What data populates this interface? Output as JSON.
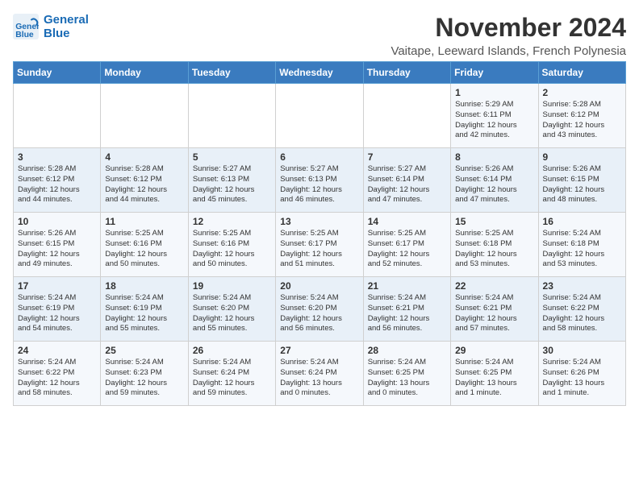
{
  "header": {
    "logo_line1": "General",
    "logo_line2": "Blue",
    "month_title": "November 2024",
    "location": "Vaitape, Leeward Islands, French Polynesia"
  },
  "weekdays": [
    "Sunday",
    "Monday",
    "Tuesday",
    "Wednesday",
    "Thursday",
    "Friday",
    "Saturday"
  ],
  "weeks": [
    [
      {
        "day": "",
        "info": ""
      },
      {
        "day": "",
        "info": ""
      },
      {
        "day": "",
        "info": ""
      },
      {
        "day": "",
        "info": ""
      },
      {
        "day": "",
        "info": ""
      },
      {
        "day": "1",
        "info": "Sunrise: 5:29 AM\nSunset: 6:11 PM\nDaylight: 12 hours\nand 42 minutes."
      },
      {
        "day": "2",
        "info": "Sunrise: 5:28 AM\nSunset: 6:12 PM\nDaylight: 12 hours\nand 43 minutes."
      }
    ],
    [
      {
        "day": "3",
        "info": "Sunrise: 5:28 AM\nSunset: 6:12 PM\nDaylight: 12 hours\nand 44 minutes."
      },
      {
        "day": "4",
        "info": "Sunrise: 5:28 AM\nSunset: 6:12 PM\nDaylight: 12 hours\nand 44 minutes."
      },
      {
        "day": "5",
        "info": "Sunrise: 5:27 AM\nSunset: 6:13 PM\nDaylight: 12 hours\nand 45 minutes."
      },
      {
        "day": "6",
        "info": "Sunrise: 5:27 AM\nSunset: 6:13 PM\nDaylight: 12 hours\nand 46 minutes."
      },
      {
        "day": "7",
        "info": "Sunrise: 5:27 AM\nSunset: 6:14 PM\nDaylight: 12 hours\nand 47 minutes."
      },
      {
        "day": "8",
        "info": "Sunrise: 5:26 AM\nSunset: 6:14 PM\nDaylight: 12 hours\nand 47 minutes."
      },
      {
        "day": "9",
        "info": "Sunrise: 5:26 AM\nSunset: 6:15 PM\nDaylight: 12 hours\nand 48 minutes."
      }
    ],
    [
      {
        "day": "10",
        "info": "Sunrise: 5:26 AM\nSunset: 6:15 PM\nDaylight: 12 hours\nand 49 minutes."
      },
      {
        "day": "11",
        "info": "Sunrise: 5:25 AM\nSunset: 6:16 PM\nDaylight: 12 hours\nand 50 minutes."
      },
      {
        "day": "12",
        "info": "Sunrise: 5:25 AM\nSunset: 6:16 PM\nDaylight: 12 hours\nand 50 minutes."
      },
      {
        "day": "13",
        "info": "Sunrise: 5:25 AM\nSunset: 6:17 PM\nDaylight: 12 hours\nand 51 minutes."
      },
      {
        "day": "14",
        "info": "Sunrise: 5:25 AM\nSunset: 6:17 PM\nDaylight: 12 hours\nand 52 minutes."
      },
      {
        "day": "15",
        "info": "Sunrise: 5:25 AM\nSunset: 6:18 PM\nDaylight: 12 hours\nand 53 minutes."
      },
      {
        "day": "16",
        "info": "Sunrise: 5:24 AM\nSunset: 6:18 PM\nDaylight: 12 hours\nand 53 minutes."
      }
    ],
    [
      {
        "day": "17",
        "info": "Sunrise: 5:24 AM\nSunset: 6:19 PM\nDaylight: 12 hours\nand 54 minutes."
      },
      {
        "day": "18",
        "info": "Sunrise: 5:24 AM\nSunset: 6:19 PM\nDaylight: 12 hours\nand 55 minutes."
      },
      {
        "day": "19",
        "info": "Sunrise: 5:24 AM\nSunset: 6:20 PM\nDaylight: 12 hours\nand 55 minutes."
      },
      {
        "day": "20",
        "info": "Sunrise: 5:24 AM\nSunset: 6:20 PM\nDaylight: 12 hours\nand 56 minutes."
      },
      {
        "day": "21",
        "info": "Sunrise: 5:24 AM\nSunset: 6:21 PM\nDaylight: 12 hours\nand 56 minutes."
      },
      {
        "day": "22",
        "info": "Sunrise: 5:24 AM\nSunset: 6:21 PM\nDaylight: 12 hours\nand 57 minutes."
      },
      {
        "day": "23",
        "info": "Sunrise: 5:24 AM\nSunset: 6:22 PM\nDaylight: 12 hours\nand 58 minutes."
      }
    ],
    [
      {
        "day": "24",
        "info": "Sunrise: 5:24 AM\nSunset: 6:22 PM\nDaylight: 12 hours\nand 58 minutes."
      },
      {
        "day": "25",
        "info": "Sunrise: 5:24 AM\nSunset: 6:23 PM\nDaylight: 12 hours\nand 59 minutes."
      },
      {
        "day": "26",
        "info": "Sunrise: 5:24 AM\nSunset: 6:24 PM\nDaylight: 12 hours\nand 59 minutes."
      },
      {
        "day": "27",
        "info": "Sunrise: 5:24 AM\nSunset: 6:24 PM\nDaylight: 13 hours\nand 0 minutes."
      },
      {
        "day": "28",
        "info": "Sunrise: 5:24 AM\nSunset: 6:25 PM\nDaylight: 13 hours\nand 0 minutes."
      },
      {
        "day": "29",
        "info": "Sunrise: 5:24 AM\nSunset: 6:25 PM\nDaylight: 13 hours\nand 1 minute."
      },
      {
        "day": "30",
        "info": "Sunrise: 5:24 AM\nSunset: 6:26 PM\nDaylight: 13 hours\nand 1 minute."
      }
    ]
  ]
}
